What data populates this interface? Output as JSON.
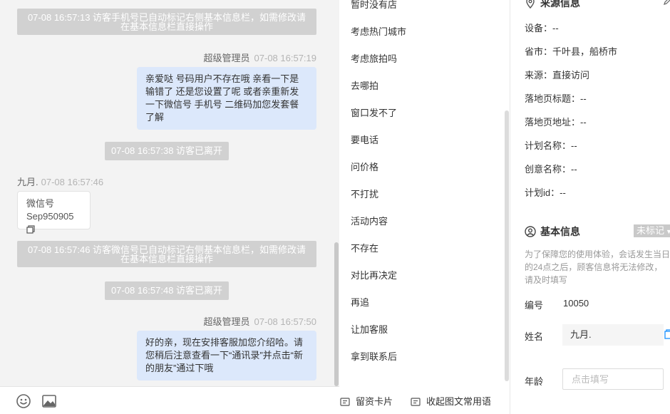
{
  "chat": {
    "sys_msg_1": "07-08 16:57:13 访客手机号已自动标记右侧基本信息栏，如需修改请在基本信息栏直接操作",
    "agent_name": "超级管理员",
    "agent_time_1": "07-08 16:57:19",
    "agent_msg_1": "亲爱哒 号码用户不存在哦 亲看一下是输错了 还是您设置了呢 或者亲重新发一下微信号 手机号 二维码加您发套餐了解",
    "sys_leave_1": "07-08 16:57:38 访客已离开",
    "visitor_name": "九月.",
    "visitor_time": "07-08 16:57:46",
    "visitor_msg_line1": "微信号",
    "visitor_msg_line2": "Sep950905",
    "sys_msg_2": "07-08 16:57:46 访客微信号已自动标记右侧基本信息栏，如需修改请在基本信息栏直接操作",
    "sys_leave_2": "07-08 16:57:48 访客已离开",
    "agent_time_2": "07-08 16:57:50",
    "agent_msg_2": "好的亲，现在安排客服加您介绍哈。请您稍后注意查看一下“通讯录”并点击“新的朋友”通过下哦"
  },
  "toolbar": {
    "emoji_icon": "smiley-icon",
    "image_icon": "image-icon"
  },
  "replies": {
    "items": [
      "暂时没有店",
      "考虑热门城市",
      "考虑旅拍吗",
      "去哪拍",
      "窗口发不了",
      "要电话",
      "问价格",
      "不打扰",
      "活动内容",
      "不存在",
      "对比再决定",
      "再追",
      "让加客服",
      "拿到联系后"
    ],
    "leave_card": "留资卡片",
    "collapse_phrases": "收起图文常用语"
  },
  "info": {
    "source_title": "来源信息",
    "device": "设备：--",
    "province_city": "省市：千叶县，船桥市",
    "source": "来源：直接访问",
    "landing_title": "落地页标题：--",
    "landing_url": "落地页地址：--",
    "plan_name": "计划名称：--",
    "creative_name": "创意名称：--",
    "plan_id": "计划id：--",
    "basic_title": "基本信息",
    "tag": "未标记",
    "notice": "为了保障您的使用体验，会话发生当日的24点之后，顾客信息将无法修改，请及时填写",
    "id_label": "编号",
    "id_value": "10050",
    "name_label": "姓名",
    "name_value": "九月.",
    "age_label": "年龄",
    "age_placeholder": "点击填写"
  },
  "colors": {
    "agent_bubble": "#dce8fb",
    "system_notice": "#d1d1d1",
    "chat_bg": "#f3f3f3",
    "accent": "#1890ff"
  }
}
